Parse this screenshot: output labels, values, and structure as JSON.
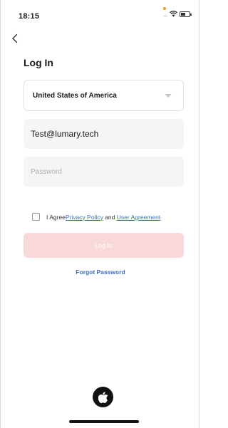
{
  "status_bar": {
    "time": "18:15",
    "icons": [
      "signal-icon",
      "wifi-icon",
      "battery-icon"
    ],
    "dots": "....."
  },
  "header": {
    "back_icon": "chevron-left-icon",
    "title": "Log In"
  },
  "form": {
    "country": "United States of America",
    "email_value": "Test@lumary.tech",
    "password_placeholder": "Password",
    "agree": {
      "prefix": "I Agree",
      "privacy_policy": "Privacy Policy",
      "and": " and ",
      "user_agreement": "User Agreement",
      "checked": false
    },
    "login_label": "Log In",
    "forgot_password": "Forgot Password"
  },
  "social": {
    "apple_icon": "apple-icon"
  },
  "colors": {
    "accent_link": "#3a6fc4",
    "login_disabled": "#f8d8d8",
    "field_bg": "#f5f5f5"
  }
}
